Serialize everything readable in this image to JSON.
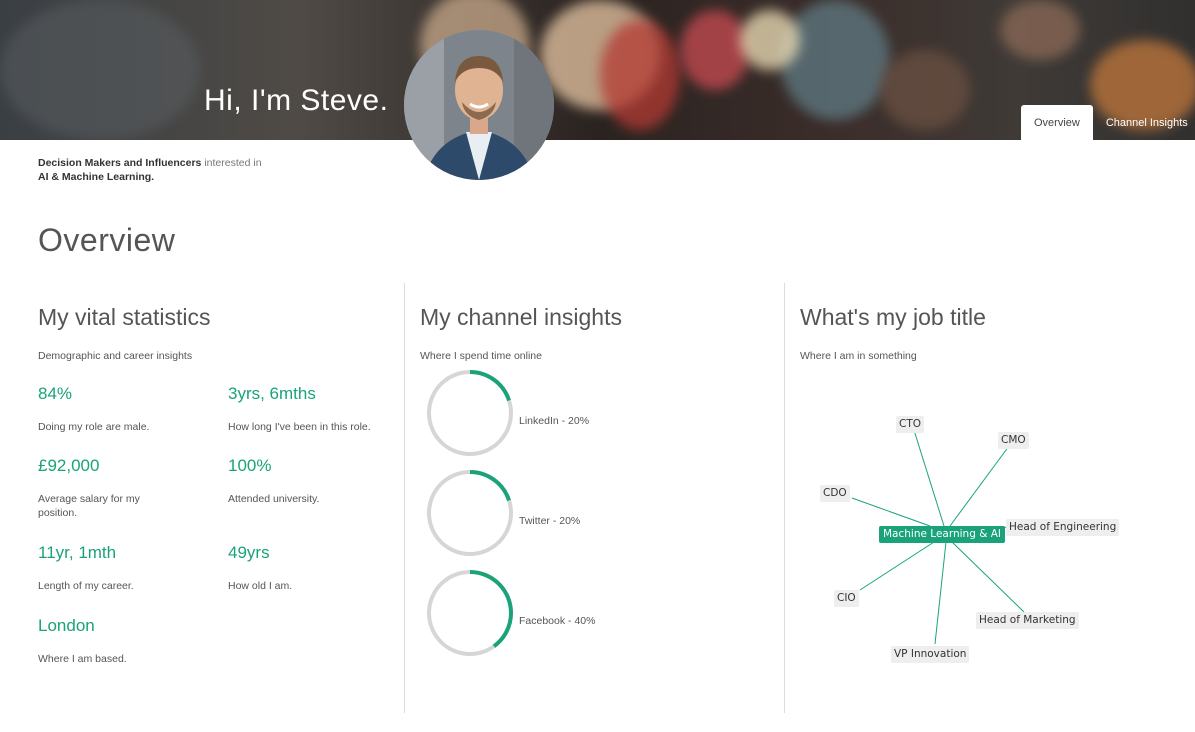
{
  "hero": {
    "greeting": "Hi, I'm Steve."
  },
  "tabs": [
    {
      "label": "Overview",
      "active": true
    },
    {
      "label": "Channel Insights",
      "active": false
    }
  ],
  "interest": {
    "audience": "Decision Makers and Influencers",
    "connector": "interested in",
    "topic": "AI & Machine Learning."
  },
  "page_title": "Overview",
  "vital_statistics": {
    "title": "My vital statistics",
    "subtitle": "Demographic and career insights",
    "stats": [
      {
        "value": "84%",
        "description": "Doing my role are male."
      },
      {
        "value": "3yrs, 6mths",
        "description": "How long I've been in this role."
      },
      {
        "value": "£92,000",
        "description": "Average salary for my position."
      },
      {
        "value": "100%",
        "description": "Attended university."
      },
      {
        "value": "11yr, 1mth",
        "description": "Length of my career."
      },
      {
        "value": "49yrs",
        "description": "How old I am."
      },
      {
        "value": "London",
        "description": "Where I am based."
      }
    ]
  },
  "channel_insights": {
    "title": "My channel insights",
    "subtitle": "Where I spend time online",
    "channels": [
      {
        "label": "LinkedIn - 20%",
        "percent": 20
      },
      {
        "label": "Twitter - 20%",
        "percent": 20
      },
      {
        "label": "Facebook - 40%",
        "percent": 40
      }
    ]
  },
  "job_title": {
    "title": "What's my job title",
    "subtitle": "Where I am in something",
    "center": "Machine Learning & AI",
    "nodes": [
      "CTO",
      "CMO",
      "CDO",
      "Head of Engineering",
      "CIO",
      "Head of Marketing",
      "VP Innovation"
    ]
  },
  "colors": {
    "accent": "#1aa37a",
    "ring_track": "#d6d6d6",
    "text": "#555555"
  }
}
